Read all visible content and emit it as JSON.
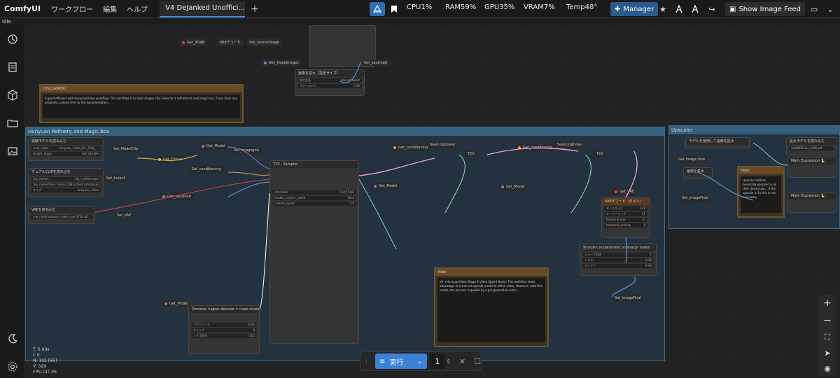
{
  "app": {
    "logo": "ComfyUI",
    "status": "Idle"
  },
  "menu": [
    "ワークフロー",
    "編集",
    "ヘルプ"
  ],
  "workflow_tab": {
    "label": "V4 DeJanked Unoffici..."
  },
  "stats": {
    "cpu": "CPU1%",
    "ram": "RAM59%",
    "gpu": "GPU35%",
    "vram": "VRAM7%",
    "temp": "Temp48°"
  },
  "toolbar": {
    "manager_label": "Manager",
    "feed_label": "Show Image Feed"
  },
  "groups": {
    "refine": "Hunyuan Refinery and Magic Box",
    "upscaler": "Upscaler"
  },
  "nodes": {
    "disclaimer_title": "DISCLAIMER:",
    "disclaimer_text": "A good efficient with HunyuanVideo workflow. This workflow is to take images into video for a refinement and magic box, if you have any problems, please refer to the documentation...",
    "resize_title": "画像を拡大（指定サイズ）",
    "resize_w1": "拡大方法",
    "resize_v1": "nearest-exact",
    "resize_w2": "スケールバイ",
    "resize_v2": "0.50",
    "unet_title": "拡散モデルを読み込む",
    "unet_w1": "unet_name",
    "unet_v1": "hunyuan_video_t2v_720p_...",
    "unet_w2": "weight_dtype",
    "unet_v2": "fp8_e4m3fn",
    "clip_title": "デュアルCLIPを読み込む",
    "clip_w1": "clip_name1",
    "clip_v1": "clip_l.safetensors",
    "clip_w2": "clip_name2",
    "clip_v2": "llava_llama3_fp8_scaled.safetensors",
    "clip_w3": "タイプ",
    "clip_v3": "hunyuan_video",
    "vae_title": "VAEを読み込む",
    "vae_w1": "vae_name",
    "vae_v1": "hunyuan_video_vae_bf16.saf...",
    "sampler_title": "Sampler",
    "sampler_w1": "scheduler",
    "sampler_v1": "Fast (7.8s)",
    "sampler_w2": "enable_custom_speed",
    "sampler_v2": "false",
    "sampler_w3": "custom_speed",
    "sampler_v3": "1.0",
    "denoise_title": "Denoise, higher denoise = more change",
    "denoise_w1": "スケジューラ",
    "denoise_v1": "beta",
    "denoise_w2": "ステップ",
    "denoise_v2": "8",
    "denoise_w3": "ノイズ除去",
    "denoise_v3": "0.65",
    "note_title": "Note",
    "note_text": "V4 +HunyuanVideo Stage 2 Video Speed Boost. This workflow takes advantage of a trained upscale model to refine video. However, note this model, the process is guided by a pre-generated video...",
    "vae_tiled_title": "VAEデコード（タイル）",
    "tiled_w1": "タイルサイズ",
    "tiled_v1": "128",
    "tiled_w2": "オーバーラップ",
    "tiled_v2": "32",
    "tiled_w3": "temporal_size",
    "tiled_v3": "32",
    "tiled_w4": "temporal_overlap",
    "tiled_v4": "8",
    "sharpen_title": "Sharpen (experiment on sharp? lower)",
    "sharpen_w1": "シャープ半径",
    "sharpen_v1": "1",
    "sharpen_w2": "シグマ",
    "sharpen_v2": "0.30",
    "sharpen_w3": "アルファ",
    "sharpen_v3": "0.40",
    "upscale_model_title": "モデルを使用して画像を拡大",
    "upscale_load_title": "拡大モデルを読み込む",
    "upscale_load_v": "4xNMKDSiax_200k.pth",
    "upscale_note_title": "Note",
    "upscale_note_text": "Upscale method. Generally upscale by 4x then downscale... If the upscale is 2x this is not necessary.",
    "math1": "Math Expression 🐍",
    "math2": "Math Expression 🐍",
    "scale_title": "画像を拡大",
    "t2v_label_1": "T2V",
    "t2v_label_2": "T2V",
    "t2v_label_3": "T2V"
  },
  "pills": {
    "get_vae_top": "Get_XDAB",
    "vae_decode_top": "VAEデコード",
    "set_sourceimage": "Set_sourceimage",
    "get_deepimages": "Get_DeepImages",
    "set_squished": "Set_squished",
    "set_modelclip": "Set_ModelClip",
    "get_model": "Get_Model",
    "get_clipce": "Get_Clipce",
    "set_conditioning": "Set_conditioning",
    "set_imagegen": "Set_imagegen",
    "set_loracli": "Set_Loracli",
    "get_squished": "Get_squished",
    "set_vae": "Set_VAE",
    "get_model2": "Get_Model",
    "get_conditioning": "Get_conditioning",
    "get_model3": "Get_Model",
    "get_conditioning2": "Get_conditioning",
    "get_model4": "Get_Model",
    "get_vae": "Get_VAE",
    "set_imagefinal": "Set_imageFinal",
    "set_imagefinal2": "Set_imageFinal",
    "seed1": "Seed (rgthree)",
    "seed2": "Seed (rgthree)",
    "get_image_size": "Get Image Size"
  },
  "run": {
    "label": "実行",
    "count": "1"
  },
  "overlay": {
    "t": "T: 0.00s",
    "i": "I: 0",
    "n": "N: 102 [66]",
    "v": "V: 329",
    "fps": "FPS:147.06"
  }
}
